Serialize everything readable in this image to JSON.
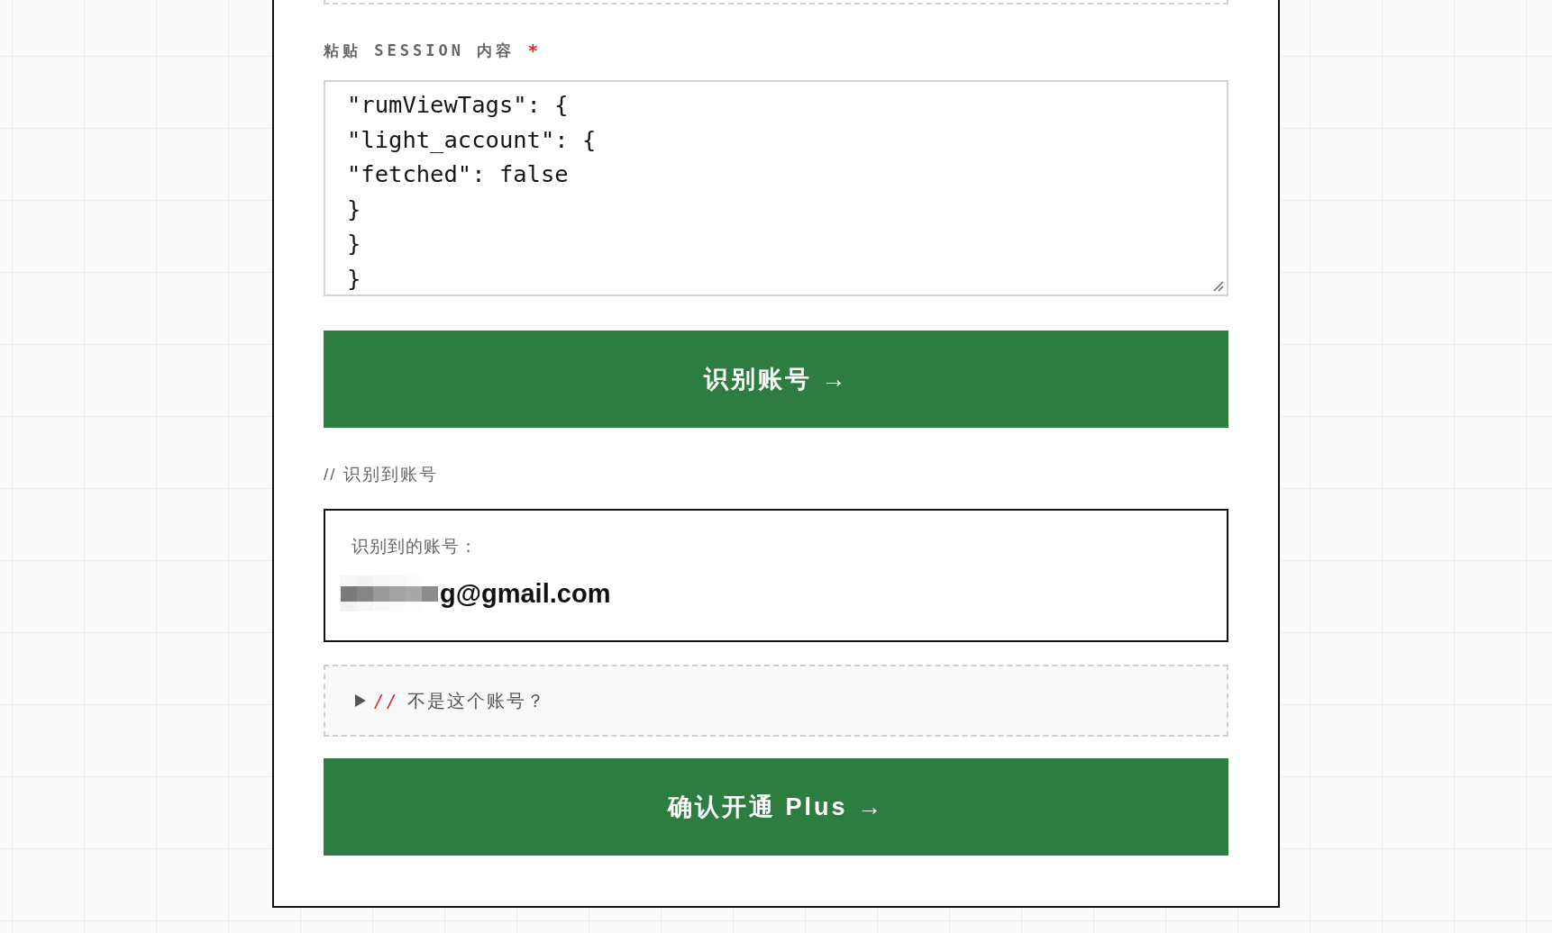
{
  "session_field": {
    "label": "粘贴 SESSION 内容",
    "required_mark": "*",
    "value": "\"rumViewTags\": {\n\"light_account\": {\n\"fetched\": false\n}\n}\n}"
  },
  "identify_button": {
    "label": "识别账号 →"
  },
  "detected_section": {
    "heading": "// 识别到账号"
  },
  "account_card": {
    "label": "识别到的账号：",
    "email": "g@gmail.com",
    "redacted": true
  },
  "not_this_account": {
    "expanded": false,
    "prefix": "//",
    "label": "不是这个账号？"
  },
  "confirm_button": {
    "label": "确认开通 Plus →"
  }
}
